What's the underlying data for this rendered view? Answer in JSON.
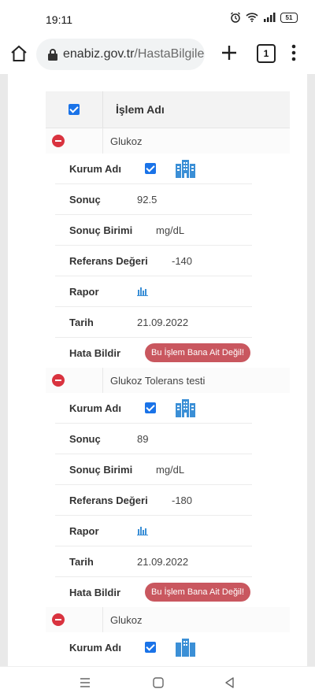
{
  "status_bar": {
    "time": "19:11",
    "battery": "51"
  },
  "browser": {
    "url_domain": "enabiz.gov.tr",
    "url_path": "/HastaBilgileri/T",
    "tab_count": "1"
  },
  "table": {
    "header_title": "İşlem Adı",
    "groups": [
      {
        "name": "Glukoz",
        "labels": {
          "kurum": "Kurum Adı",
          "sonuc": "Sonuç",
          "birim": "Sonuç Birimi",
          "referans": "Referans Değeri",
          "rapor": "Rapor",
          "tarih": "Tarih",
          "hata": "Hata Bildir"
        },
        "sonuc": "92.5",
        "birim": "mg/dL",
        "referans": "-140",
        "tarih": "21.09.2022",
        "report_button": "Bu İşlem Bana Ait Değil!"
      },
      {
        "name": "Glukoz Tolerans testi",
        "labels": {
          "kurum": "Kurum Adı",
          "sonuc": "Sonuç",
          "birim": "Sonuç Birimi",
          "referans": "Referans Değeri",
          "rapor": "Rapor",
          "tarih": "Tarih",
          "hata": "Hata Bildir"
        },
        "sonuc": "89",
        "birim": "mg/dL",
        "referans": "-180",
        "tarih": "21.09.2022",
        "report_button": "Bu İşlem Bana Ait Değil!"
      },
      {
        "name": "Glukoz",
        "labels": {
          "kurum": "Kurum Adı"
        }
      }
    ]
  },
  "colors": {
    "checkbox": "#1a73e8",
    "minus": "#d9333f",
    "report_button": "#c9575f",
    "building_icon": "#3b8fd6"
  },
  "icons": [
    "home-icon",
    "lock-icon",
    "plus-icon",
    "tabs-icon",
    "menu-icon",
    "building-icon",
    "bar-chart-icon",
    "minus-circle-icon"
  ]
}
